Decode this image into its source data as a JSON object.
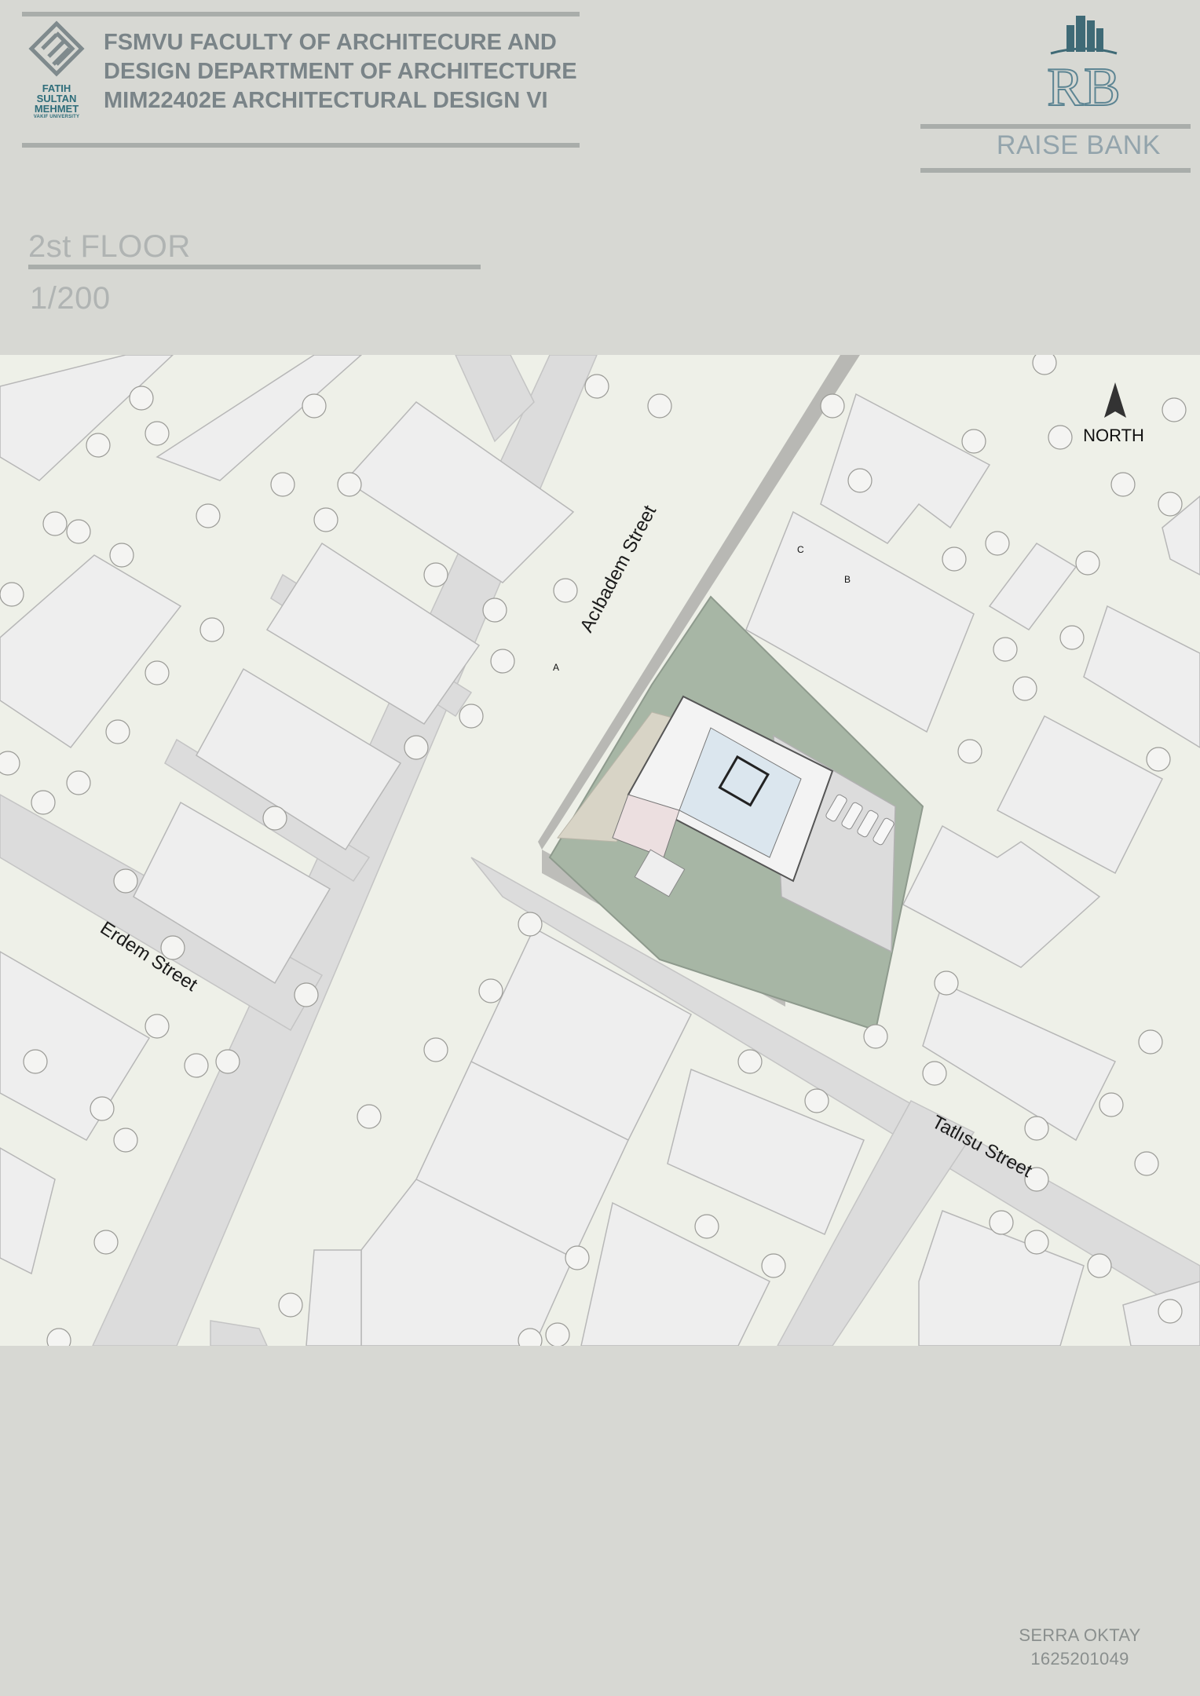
{
  "header": {
    "lines": [
      "FSMVU FACULTY OF ARCHITECURE AND",
      "DESIGN DEPARTMENT OF ARCHITECTURE",
      "MIM22402E ARCHITECTURAL DESIGN VI"
    ],
    "university_logo": {
      "icon": "university-emblem-icon",
      "text_lines": [
        "FATIH",
        "SULTAN",
        "MEHMET"
      ],
      "subtext": "VAKIF UNIVERSITY"
    }
  },
  "brand": {
    "logo_icon": "rb-monogram-skyline-icon",
    "monogram": "RB",
    "name": "RAISE BANK"
  },
  "drawing": {
    "title": "2st FLOOR",
    "scale": "1/200"
  },
  "map": {
    "north_label": "NORTH",
    "streets": [
      "Acıbadem Street",
      "Erdem Street",
      "Tatlısu Street"
    ],
    "section_marks": [
      "A",
      "B",
      "C"
    ],
    "colors": {
      "background": "#eef0e8",
      "road": "#dcdcdc",
      "building": "#eeeeee",
      "green": "#a7b6a5",
      "interior_blue": "#dbe6ee",
      "interior_pink": "#ecdfe0"
    }
  },
  "author": {
    "name": "SERRA OKTAY",
    "student_id": "1625201049"
  },
  "colors": {
    "page_background": "#d7d8d3",
    "header_text": "#7a8488",
    "accent_teal": "#2e6d7a"
  }
}
